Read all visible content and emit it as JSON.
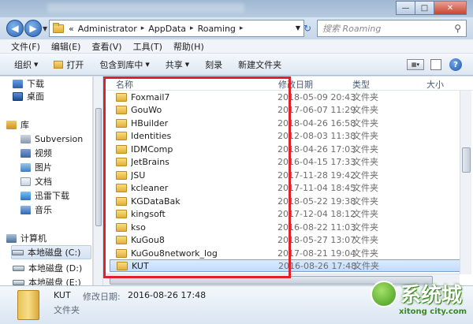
{
  "window": {
    "minimize_glyph": "—",
    "maximize_glyph": "□",
    "close_glyph": "✕"
  },
  "nav": {
    "back_glyph": "◀",
    "forward_glyph": "▶",
    "refresh_glyph": "↻"
  },
  "address": {
    "prefix": "«",
    "crumbs": [
      "Administrator",
      "AppData",
      "Roaming"
    ]
  },
  "search": {
    "placeholder": "搜索 Roaming"
  },
  "menu": [
    "文件(F)",
    "编辑(E)",
    "查看(V)",
    "工具(T)",
    "帮助(H)"
  ],
  "toolbar": {
    "organize": "组织",
    "open": "打开",
    "include": "包含到库中",
    "share": "共享",
    "burn": "刻录",
    "new_folder": "新建文件夹"
  },
  "sidebar": {
    "items": [
      {
        "label": "下载",
        "icon": "download-icon"
      },
      {
        "label": "桌面",
        "icon": "desktop-icon"
      },
      {
        "label": "库",
        "icon": "library-icon"
      },
      {
        "label": "Subversion",
        "icon": "subversion-icon"
      },
      {
        "label": "视频",
        "icon": "video-icon"
      },
      {
        "label": "图片",
        "icon": "picture-icon"
      },
      {
        "label": "文档",
        "icon": "document-icon"
      },
      {
        "label": "迅雷下载",
        "icon": "thunder-icon"
      },
      {
        "label": "音乐",
        "icon": "music-icon"
      },
      {
        "label": "计算机",
        "icon": "computer-icon"
      },
      {
        "label": "本地磁盘 (C:)",
        "icon": "drive-icon"
      },
      {
        "label": "本地磁盘 (D:)",
        "icon": "drive-icon"
      },
      {
        "label": "本地磁盘 (E:)",
        "icon": "drive-icon"
      }
    ]
  },
  "columns": {
    "name": "名称",
    "date": "修改日期",
    "type": "类型",
    "size": "大小"
  },
  "files": [
    {
      "name": "Foxmail7",
      "date": "2018-05-09 20:43",
      "type": "文件夹"
    },
    {
      "name": "GouWo",
      "date": "2017-06-07 11:29",
      "type": "文件夹"
    },
    {
      "name": "HBuilder",
      "date": "2018-04-26 16:58",
      "type": "文件夹"
    },
    {
      "name": "Identities",
      "date": "2012-08-03 11:38",
      "type": "文件夹"
    },
    {
      "name": "IDMComp",
      "date": "2018-04-26 17:03",
      "type": "文件夹"
    },
    {
      "name": "JetBrains",
      "date": "2016-04-15 17:33",
      "type": "文件夹"
    },
    {
      "name": "JSU",
      "date": "2017-11-28 19:42",
      "type": "文件夹"
    },
    {
      "name": "kcleaner",
      "date": "2017-11-04 18:45",
      "type": "文件夹"
    },
    {
      "name": "KGDataBak",
      "date": "2018-05-22 19:38",
      "type": "文件夹"
    },
    {
      "name": "kingsoft",
      "date": "2017-12-04 18:12",
      "type": "文件夹"
    },
    {
      "name": "kso",
      "date": "2016-08-22 11:03",
      "type": "文件夹"
    },
    {
      "name": "KuGou8",
      "date": "2018-05-27 13:07",
      "type": "文件夹"
    },
    {
      "name": "KuGou8network_log",
      "date": "2017-08-21 19:04",
      "type": "文件夹"
    },
    {
      "name": "KUT",
      "date": "2016-08-26 17:48",
      "type": "文件夹"
    }
  ],
  "details": {
    "name": "KUT",
    "date_label": "修改日期:",
    "date": "2016-08-26 17:48",
    "type": "文件夹"
  },
  "watermark": {
    "text": "系统城",
    "sub": "xitong city.com"
  },
  "colors": {
    "highlight_box": "#e2202b",
    "selection": "#c1dbfc"
  }
}
